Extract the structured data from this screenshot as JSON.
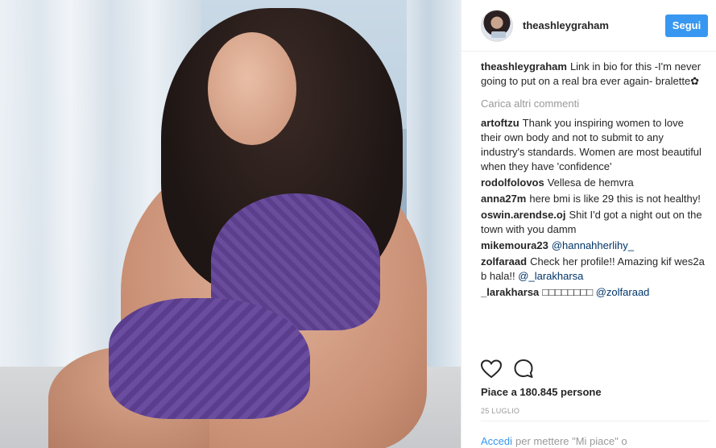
{
  "post": {
    "image_alt": "Woman in purple lace bralette and briefs sitting by a window"
  },
  "header": {
    "username": "theashleygraham",
    "follow_label": "Segui"
  },
  "caption": {
    "username": "theashleygraham",
    "text": "Link in bio for this -I'm never going to put on a real bra ever again- bralette✿"
  },
  "load_more": "Carica altri commenti",
  "comments": [
    {
      "user": "artoftzu",
      "text": "Thank you inspiring women to love their own body and not to submit to any industry's standards. Women are most beautiful when they have 'confidence'"
    },
    {
      "user": "rodolfolovos",
      "text": "Vellesa de hemvra"
    },
    {
      "user": "anna27m",
      "text": "here bmi is like 29 this is not healthy!"
    },
    {
      "user": "oswin.arendse.oj",
      "text": "Shit I'd got a night out on the town with you damm"
    },
    {
      "user": "mikemoura23",
      "text": "",
      "mention": "@hannahherlihy_"
    },
    {
      "user": "zolfaraad",
      "text": "Check her profile!! Amazing kif wes2a b hala!!",
      "mention": "@_larakharsa"
    },
    {
      "user": "_larakharsa",
      "text": "□□□□□□□□",
      "mention": "@zolfaraad"
    }
  ],
  "likes": "Piace a 180.845 persone",
  "date": "25 LUGLIO",
  "footer": {
    "login_link": "Accedi",
    "login_text": "per mettere \"Mi piace\" o"
  },
  "colors": {
    "accent": "#3897f0",
    "mention": "#003569",
    "muted": "#999999"
  },
  "icons": [
    "heart-icon",
    "comment-icon"
  ]
}
